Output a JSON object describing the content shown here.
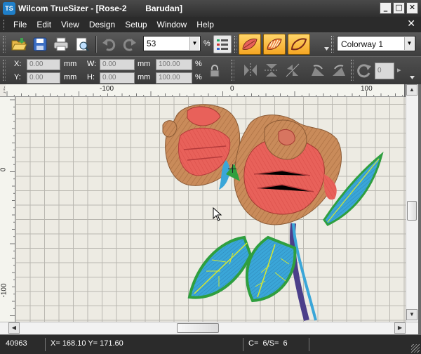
{
  "window": {
    "logo": "TS",
    "title": "Wilcom TrueSizer - [Rose-2        Barudan]",
    "minimize_glyph": "_",
    "maximize_glyph": "□",
    "close_glyph": "✕"
  },
  "menubar": {
    "items": [
      "File",
      "Edit",
      "View",
      "Design",
      "Setup",
      "Window",
      "Help"
    ],
    "doc_close_glyph": "✕"
  },
  "toolbar": {
    "zoom_value": "53",
    "zoom_unit": "%",
    "colorway": "Colorway 1",
    "icons": [
      "open-folder-icon",
      "save-icon",
      "print-icon",
      "print-preview-icon",
      "undo-icon",
      "redo-icon",
      "design-list-icon",
      "stitch-type-1-icon",
      "stitch-type-2-icon",
      "stitch-type-3-icon"
    ]
  },
  "transform": {
    "x_label": "X:",
    "y_label": "Y:",
    "w_label": "W:",
    "h_label": "H:",
    "x_value": "0.00",
    "y_value": "0.00",
    "w_value": "0.00",
    "h_value": "0.00",
    "w_pct": "100.00",
    "h_pct": "100.00",
    "unit": "mm",
    "pct": "%",
    "spin_value": "0"
  },
  "rulers": {
    "top_labels": [
      "-100",
      "0",
      "100"
    ],
    "left_labels": [
      "0",
      "-100"
    ]
  },
  "status": {
    "stitches": "40963",
    "coords": "X= 168.10 Y= 171.60",
    "colors": "C=  6/S=  6"
  },
  "colors": {
    "petal": "#e8615a",
    "petal_dark": "#b43b3b",
    "tan": "#c98b5a",
    "leaf_blue": "#3aa6d8",
    "leaf_green": "#2f9f3f",
    "stem": "#4b3f8a",
    "stitch_button": "#f5a623"
  }
}
